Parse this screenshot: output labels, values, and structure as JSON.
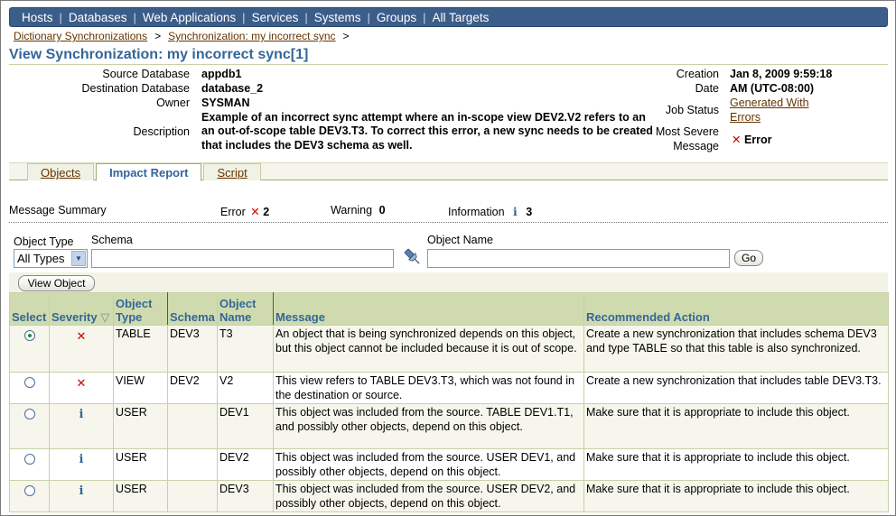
{
  "nav": {
    "items": [
      "Hosts",
      "Databases",
      "Web Applications",
      "Services",
      "Systems",
      "Groups",
      "All Targets"
    ]
  },
  "breadcrumb": {
    "items": [
      "Dictionary Synchronizations",
      "Synchronization: my incorrect sync"
    ],
    "separator": ">"
  },
  "page_title": "View Synchronization: my incorrect sync[1]",
  "details": {
    "source_db_label": "Source Database",
    "source_db": "appdb1",
    "dest_db_label": "Destination Database",
    "dest_db": "database_2",
    "owner_label": "Owner",
    "owner": "SYSMAN",
    "description_label": "Description",
    "description": "Example of an incorrect sync attempt where an in-scope view DEV2.V2 refers to an an out-of-scope table DEV3.T3. To correct this error, a new sync needs to be created that includes the DEV3 schema as well.",
    "creation_label_1": "Creation",
    "creation_label_2": "Date",
    "creation_value_1": "Jan 8, 2009 9:59:18",
    "creation_value_2": "AM (UTC-08:00)",
    "job_status_label": "Job Status",
    "job_status_1": "Generated With",
    "job_status_2": "Errors",
    "most_severe_label_1": "Most Severe",
    "most_severe_label_2": "Message",
    "most_severe": "Error"
  },
  "tabs": [
    {
      "label": "Objects",
      "active": false
    },
    {
      "label": "Impact Report",
      "active": true
    },
    {
      "label": "Script",
      "active": false
    }
  ],
  "summary": {
    "label": "Message Summary",
    "error_label": "Error",
    "error_count": "2",
    "warning_label": "Warning",
    "warning_count": "0",
    "info_label": "Information",
    "info_count": "3"
  },
  "filters": {
    "object_type_label": "Object Type",
    "object_type_value": "All Types",
    "schema_label": "Schema",
    "schema_value": "",
    "object_name_label": "Object Name",
    "object_name_value": "",
    "go_label": "Go",
    "view_object_label": "View Object"
  },
  "table": {
    "headers": {
      "select": "Select",
      "severity": "Severity",
      "object_type_1": "Object",
      "object_type_2": "Type",
      "schema": "Schema",
      "object_name_1": "Object",
      "object_name_2": "Name",
      "message": "Message",
      "action": "Recommended Action"
    },
    "rows": [
      {
        "selected": true,
        "severity": "error",
        "type": "TABLE",
        "schema": "DEV3",
        "name": "T3",
        "message": "An object that is being synchronized depends on this object, but this object cannot be included because it is out of scope.",
        "action": "Create a new synchronization that includes schema DEV3 and type TABLE so that this table is also synchronized."
      },
      {
        "selected": false,
        "severity": "error",
        "type": "VIEW",
        "schema": "DEV2",
        "name": "V2",
        "message": "This view refers to TABLE DEV3.T3, which was not found in the destination or source.",
        "action": "Create a new synchronization that includes table DEV3.T3."
      },
      {
        "selected": false,
        "severity": "info",
        "type": "USER",
        "schema": "",
        "name": "DEV1",
        "message": "This object was included from the source. TABLE DEV1.T1, and possibly other objects, depend on this object.",
        "action": "Make sure that it is appropriate to include this object."
      },
      {
        "selected": false,
        "severity": "info",
        "type": "USER",
        "schema": "",
        "name": "DEV2",
        "message": "This object was included from the source. USER DEV1, and possibly other objects, depend on this object.",
        "action": "Make sure that it is appropriate to include this object."
      },
      {
        "selected": false,
        "severity": "info",
        "type": "USER",
        "schema": "",
        "name": "DEV3",
        "message": "This object was included from the source. USER DEV2, and possibly other objects, depend on this object.",
        "action": "Make sure that it is appropriate to include this object."
      }
    ]
  },
  "colors": {
    "nav_bg": "#3b5d8a",
    "title": "#336699",
    "link": "#663300",
    "header_bg": "#cfdbaf",
    "error_icon": "#cc0000"
  },
  "icons": {
    "error": "error-x-icon",
    "info": "info-icon",
    "flashlight": "flashlight-search-icon",
    "sort": "sort-descending-icon"
  }
}
